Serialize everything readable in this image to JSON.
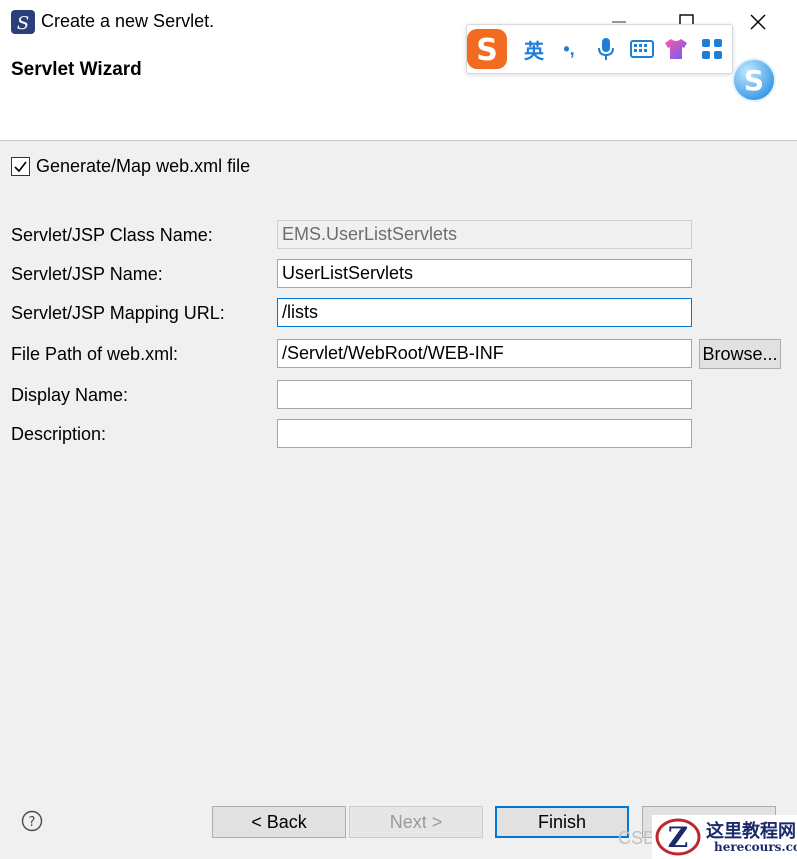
{
  "window": {
    "title": "Create a new Servlet.",
    "icon": "eclipse-servlet-icon"
  },
  "header": {
    "title": "Servlet Wizard"
  },
  "ime_toolbar": {
    "mode_label": "英",
    "punct_label": "•,",
    "icons": [
      "sogou-logo-icon",
      "microphone-icon",
      "keyboard-icon",
      "shirt-icon",
      "apps-grid-icon"
    ],
    "accent": "#1e7fd6",
    "logo_color": "#f36b21"
  },
  "options": {
    "generate_web_xml": {
      "label": "Generate/Map web.xml file",
      "checked": true
    }
  },
  "form": {
    "class_name": {
      "label": "Servlet/JSP Class Name:",
      "value": "EMS.UserListServlets"
    },
    "servlet_name": {
      "label": "Servlet/JSP Name:",
      "value": "UserListServlets"
    },
    "mapping_url": {
      "label": "Servlet/JSP Mapping URL:",
      "value": "/lists"
    },
    "web_xml_path": {
      "label": "File Path of web.xml:",
      "value": "/Servlet/WebRoot/WEB-INF"
    },
    "display_name": {
      "label": "Display Name:",
      "value": ""
    },
    "description": {
      "label": "Description:",
      "value": ""
    },
    "browse_label": "Browse..."
  },
  "footer": {
    "back_label": "< Back",
    "next_label": "Next >",
    "finish_label": "Finish",
    "csd_text": "CSD"
  },
  "watermark": {
    "cn_text": "这里教程网",
    "en_text": "herecours.com"
  }
}
